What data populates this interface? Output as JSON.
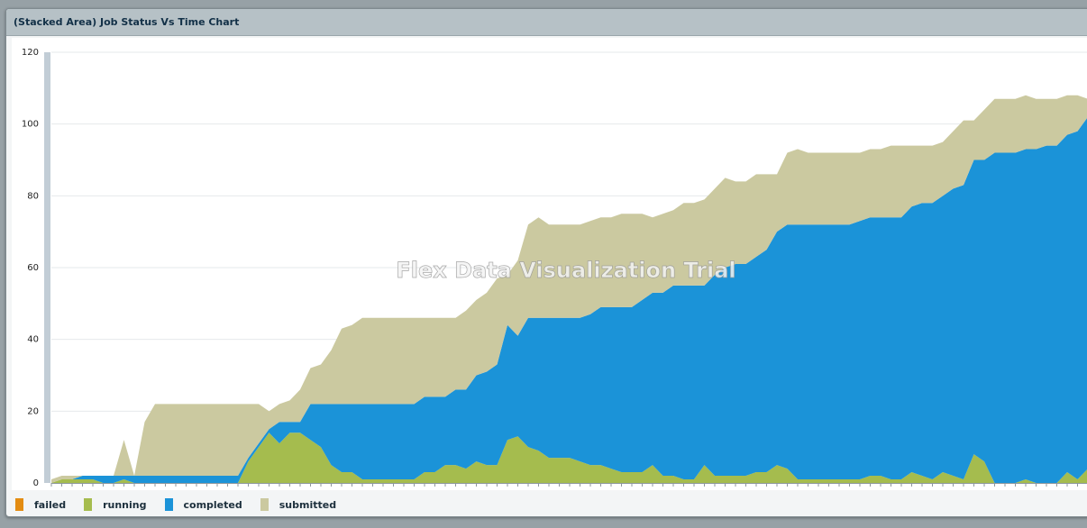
{
  "window": {
    "title": "(Stacked Area) Job Status Vs Time Chart"
  },
  "watermark": "Flex Data Visualization Trial",
  "chart_data": {
    "type": "area",
    "stacked": true,
    "title": "(Stacked Area) Job Status Vs Time Chart",
    "xlabel": "",
    "ylabel": "",
    "ylim": [
      0,
      120
    ],
    "yticks": [
      0,
      20,
      40,
      60,
      80,
      100,
      120
    ],
    "grid": "horizontal",
    "legend_position": "bottom-left",
    "x_count": 101,
    "series": [
      {
        "name": "failed",
        "color": "#e38c12",
        "values": [
          0,
          0,
          0,
          0,
          0,
          0,
          0,
          0,
          0,
          0,
          0,
          0,
          0,
          0,
          0,
          0,
          0,
          0,
          0,
          0,
          0,
          0,
          0,
          0,
          0,
          0,
          0,
          0,
          0,
          0,
          0,
          0,
          0,
          0,
          0,
          0,
          0,
          0,
          0,
          0,
          0,
          0,
          0,
          0,
          0,
          0,
          0,
          0,
          0,
          0,
          0,
          0,
          0,
          0,
          0,
          0,
          0,
          0,
          0,
          0,
          0,
          0,
          0,
          0,
          0,
          0,
          0,
          0,
          0,
          0,
          0,
          0,
          0,
          0,
          0,
          0,
          0,
          0,
          0,
          0,
          0,
          0,
          0,
          0,
          0,
          0,
          0,
          0,
          0,
          0,
          0,
          0,
          0,
          0,
          0,
          0,
          0,
          0,
          0,
          0,
          0
        ]
      },
      {
        "name": "running",
        "color": "#a5bc4e",
        "values": [
          0,
          1,
          1,
          1,
          1,
          0,
          0,
          1,
          0,
          0,
          0,
          0,
          0,
          0,
          0,
          0,
          0,
          0,
          0,
          6,
          10,
          14,
          11,
          14,
          14,
          12,
          10,
          5,
          3,
          3,
          1,
          1,
          1,
          1,
          1,
          1,
          3,
          3,
          5,
          5,
          4,
          6,
          5,
          5,
          12,
          13,
          10,
          9,
          7,
          7,
          7,
          6,
          5,
          5,
          4,
          3,
          3,
          3,
          5,
          2,
          2,
          1,
          1,
          5,
          2,
          2,
          2,
          2,
          3,
          3,
          5,
          4,
          1,
          1,
          1,
          1,
          1,
          1,
          1,
          2,
          2,
          1,
          1,
          3,
          2,
          1,
          3,
          2,
          1,
          8,
          6,
          0,
          0,
          0,
          1,
          0,
          0,
          0,
          3,
          1,
          4,
          0
        ]
      },
      {
        "name": "completed",
        "color": "#1b93d8",
        "values": [
          0,
          0,
          0,
          1,
          1,
          2,
          2,
          1,
          2,
          2,
          2,
          2,
          2,
          2,
          2,
          2,
          2,
          2,
          2,
          1,
          1,
          1,
          6,
          3,
          3,
          10,
          12,
          17,
          19,
          19,
          21,
          21,
          21,
          21,
          21,
          21,
          21,
          21,
          19,
          21,
          22,
          24,
          26,
          28,
          32,
          28,
          36,
          37,
          39,
          39,
          39,
          40,
          42,
          44,
          45,
          46,
          46,
          48,
          48,
          51,
          53,
          54,
          54,
          50,
          56,
          58,
          59,
          59,
          60,
          62,
          65,
          68,
          71,
          71,
          71,
          71,
          71,
          71,
          72,
          72,
          72,
          73,
          73,
          74,
          76,
          77,
          77,
          80,
          82,
          82,
          84,
          92,
          92,
          92,
          92,
          93,
          94,
          94,
          94,
          97,
          98,
          104
        ]
      },
      {
        "name": "submitted",
        "color": "#cbc9a0",
        "values": [
          1,
          1,
          1,
          0,
          0,
          0,
          0,
          10,
          0,
          15,
          20,
          20,
          20,
          20,
          20,
          20,
          20,
          20,
          20,
          15,
          11,
          5,
          5,
          6,
          9,
          10,
          11,
          15,
          21,
          22,
          24,
          24,
          24,
          24,
          24,
          24,
          22,
          22,
          22,
          20,
          22,
          21,
          22,
          24,
          14,
          21,
          26,
          28,
          26,
          26,
          26,
          26,
          26,
          25,
          25,
          26,
          26,
          24,
          21,
          22,
          21,
          23,
          23,
          24,
          24,
          25,
          23,
          23,
          23,
          21,
          16,
          20,
          21,
          20,
          20,
          20,
          20,
          20,
          19,
          19,
          19,
          20,
          20,
          17,
          16,
          16,
          15,
          16,
          18,
          11,
          14,
          15,
          15,
          15,
          15,
          14,
          13,
          13,
          11,
          10,
          5,
          3
        ]
      }
    ]
  }
}
